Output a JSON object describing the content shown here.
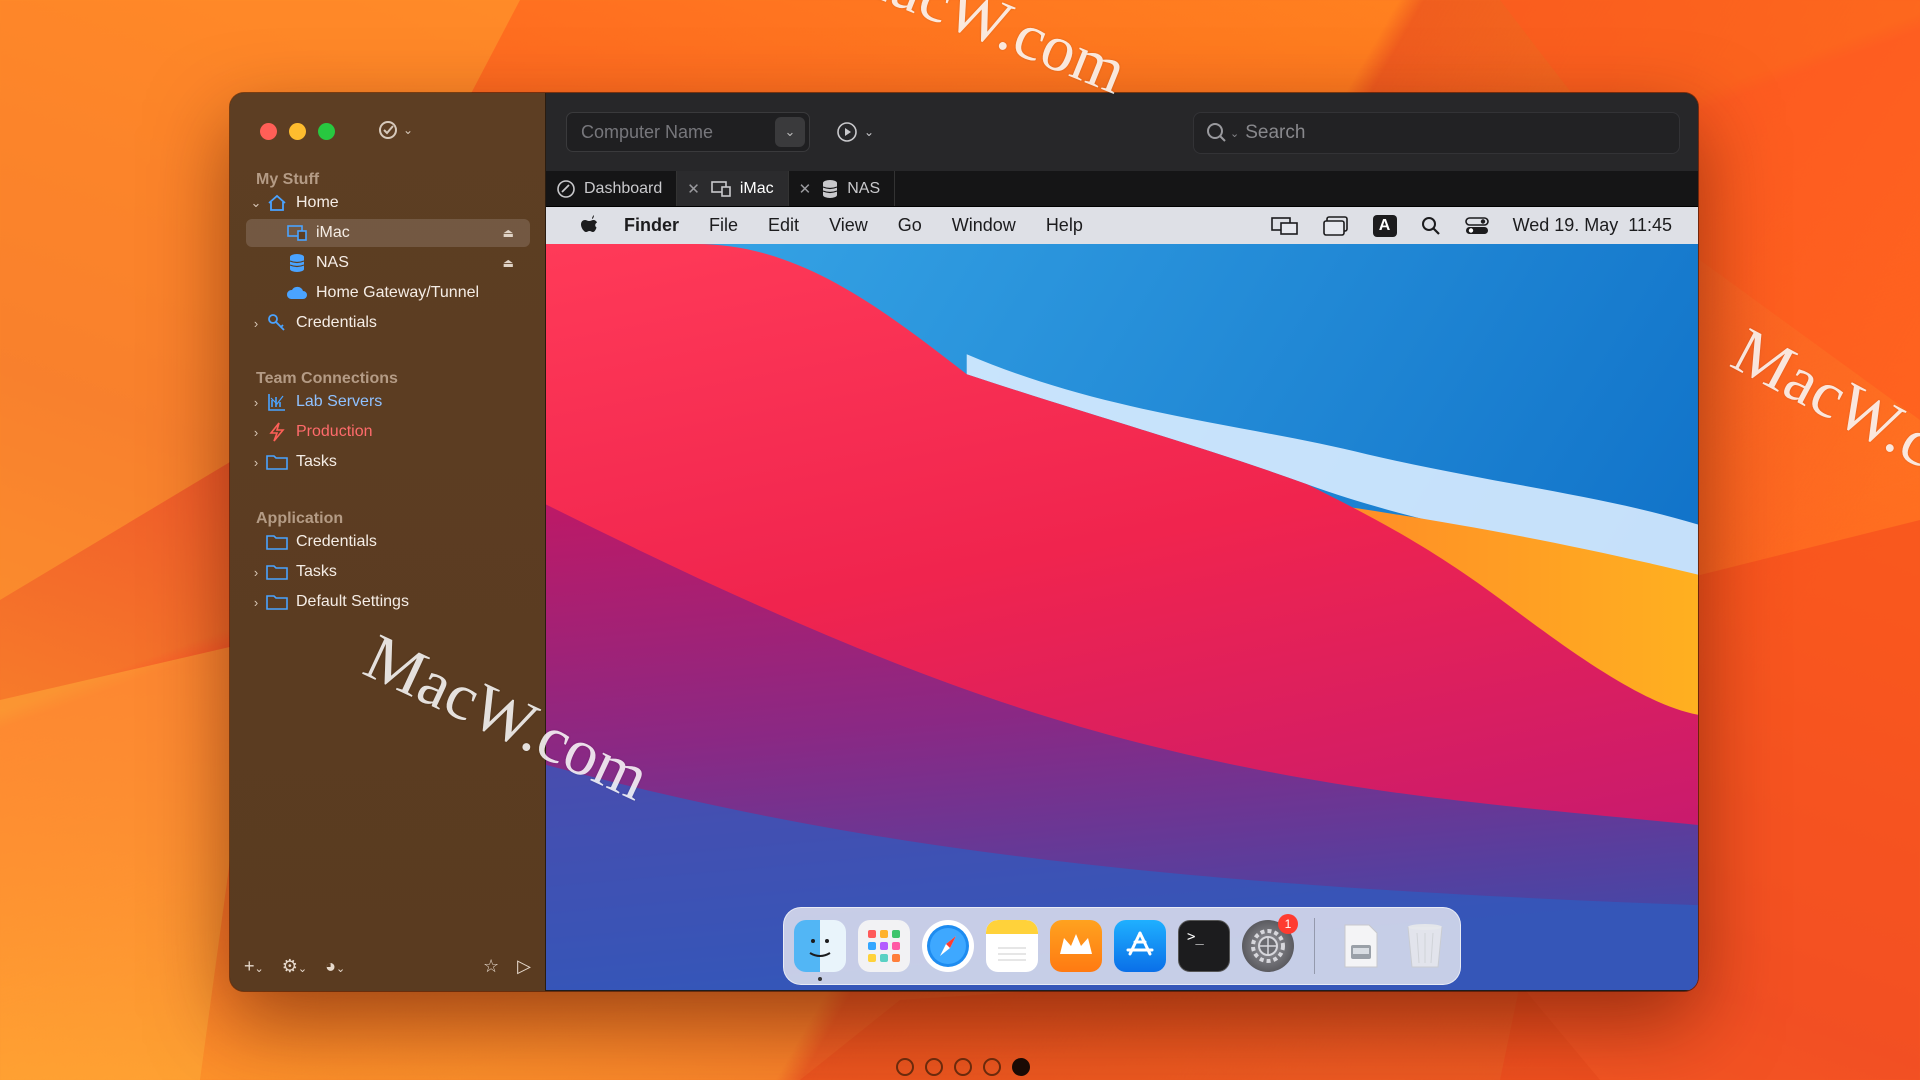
{
  "sidebar": {
    "sections": [
      {
        "title": "My Stuff"
      },
      {
        "title": "Team Connections"
      },
      {
        "title": "Application"
      }
    ],
    "items": {
      "home": "Home",
      "imac": "iMac",
      "nas": "NAS",
      "gateway": "Home Gateway/Tunnel",
      "credentials": "Credentials",
      "lab_servers": "Lab Servers",
      "production": "Production",
      "tasks": "Tasks",
      "app_credentials": "Credentials",
      "app_tasks": "Tasks",
      "default_settings": "Default Settings"
    }
  },
  "toolbar": {
    "computer_name_placeholder": "Computer Name",
    "search_placeholder": "Search"
  },
  "tabs": [
    {
      "label": "Dashboard",
      "icon": "dashboard-icon"
    },
    {
      "label": "iMac",
      "icon": "imac-icon"
    },
    {
      "label": "NAS",
      "icon": "database-icon"
    }
  ],
  "remote": {
    "menubar": {
      "app": "Finder",
      "menus": [
        "File",
        "Edit",
        "View",
        "Go",
        "Window",
        "Help"
      ],
      "datetime": "Wed 19. May  11:45"
    },
    "dock": {
      "apps": [
        "finder",
        "launchpad",
        "safari",
        "notes",
        "royal-tsx",
        "app-store",
        "terminal",
        "system-preferences"
      ],
      "system_preferences_badge": "1"
    }
  },
  "pager": {
    "count": 5,
    "active_index": 4
  },
  "watermark": "MacW.com",
  "colors": {
    "sidebar_bg": "#5c3d22",
    "accent_blue": "#0a84ff",
    "production_red": "#ff6b6b"
  }
}
